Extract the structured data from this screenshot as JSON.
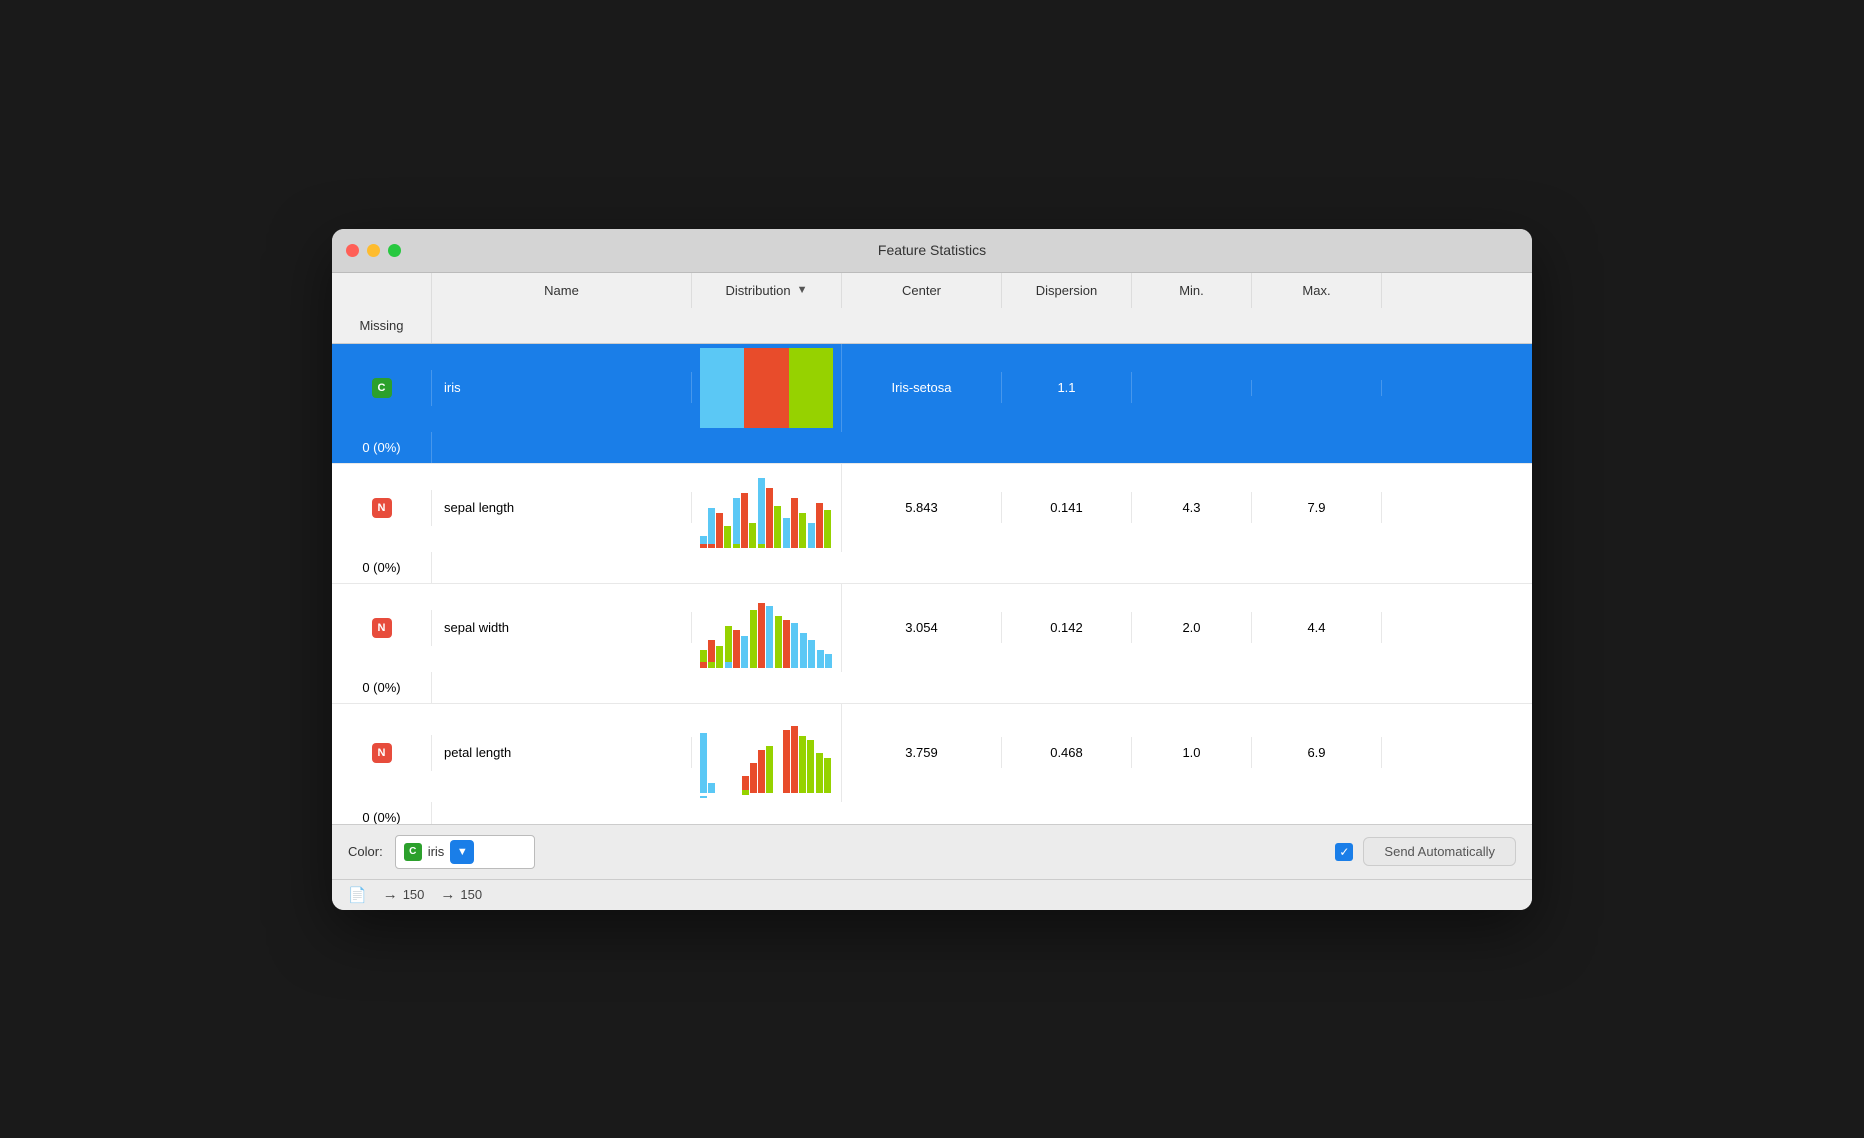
{
  "window": {
    "title": "Feature Statistics"
  },
  "header": {
    "columns": [
      "Name",
      "Distribution",
      "Center",
      "Dispersion",
      "Min.",
      "Max.",
      "Missing"
    ]
  },
  "rows": [
    {
      "id": "iris",
      "type": "C",
      "name": "iris",
      "highlighted": true,
      "center": "Iris-setosa",
      "dispersion": "1.1",
      "min": "",
      "max": "",
      "missing": "0 (0%)",
      "distType": "categorical"
    },
    {
      "id": "sepal-length",
      "type": "N",
      "name": "sepal length",
      "highlighted": false,
      "center": "5.843",
      "dispersion": "0.141",
      "min": "4.3",
      "max": "7.9",
      "missing": "0 (0%)",
      "distType": "histogram"
    },
    {
      "id": "sepal-width",
      "type": "N",
      "name": "sepal width",
      "highlighted": false,
      "center": "3.054",
      "dispersion": "0.142",
      "min": "2.0",
      "max": "4.4",
      "missing": "0 (0%)",
      "distType": "histogram"
    },
    {
      "id": "petal-length",
      "type": "N",
      "name": "petal length",
      "highlighted": false,
      "center": "3.759",
      "dispersion": "0.468",
      "min": "1.0",
      "max": "6.9",
      "missing": "0 (0%)",
      "distType": "histogram"
    }
  ],
  "footer": {
    "color_label": "Color:",
    "color_value": "iris",
    "send_auto_label": "Send Automatically"
  },
  "statusbar": {
    "count_in": "150",
    "count_out": "150"
  },
  "colors": {
    "blue": "#1a7ee8",
    "light_blue": "#5bc8f5",
    "red": "#e84c2b",
    "green": "#96d200",
    "green_badge": "#2ca02c"
  }
}
